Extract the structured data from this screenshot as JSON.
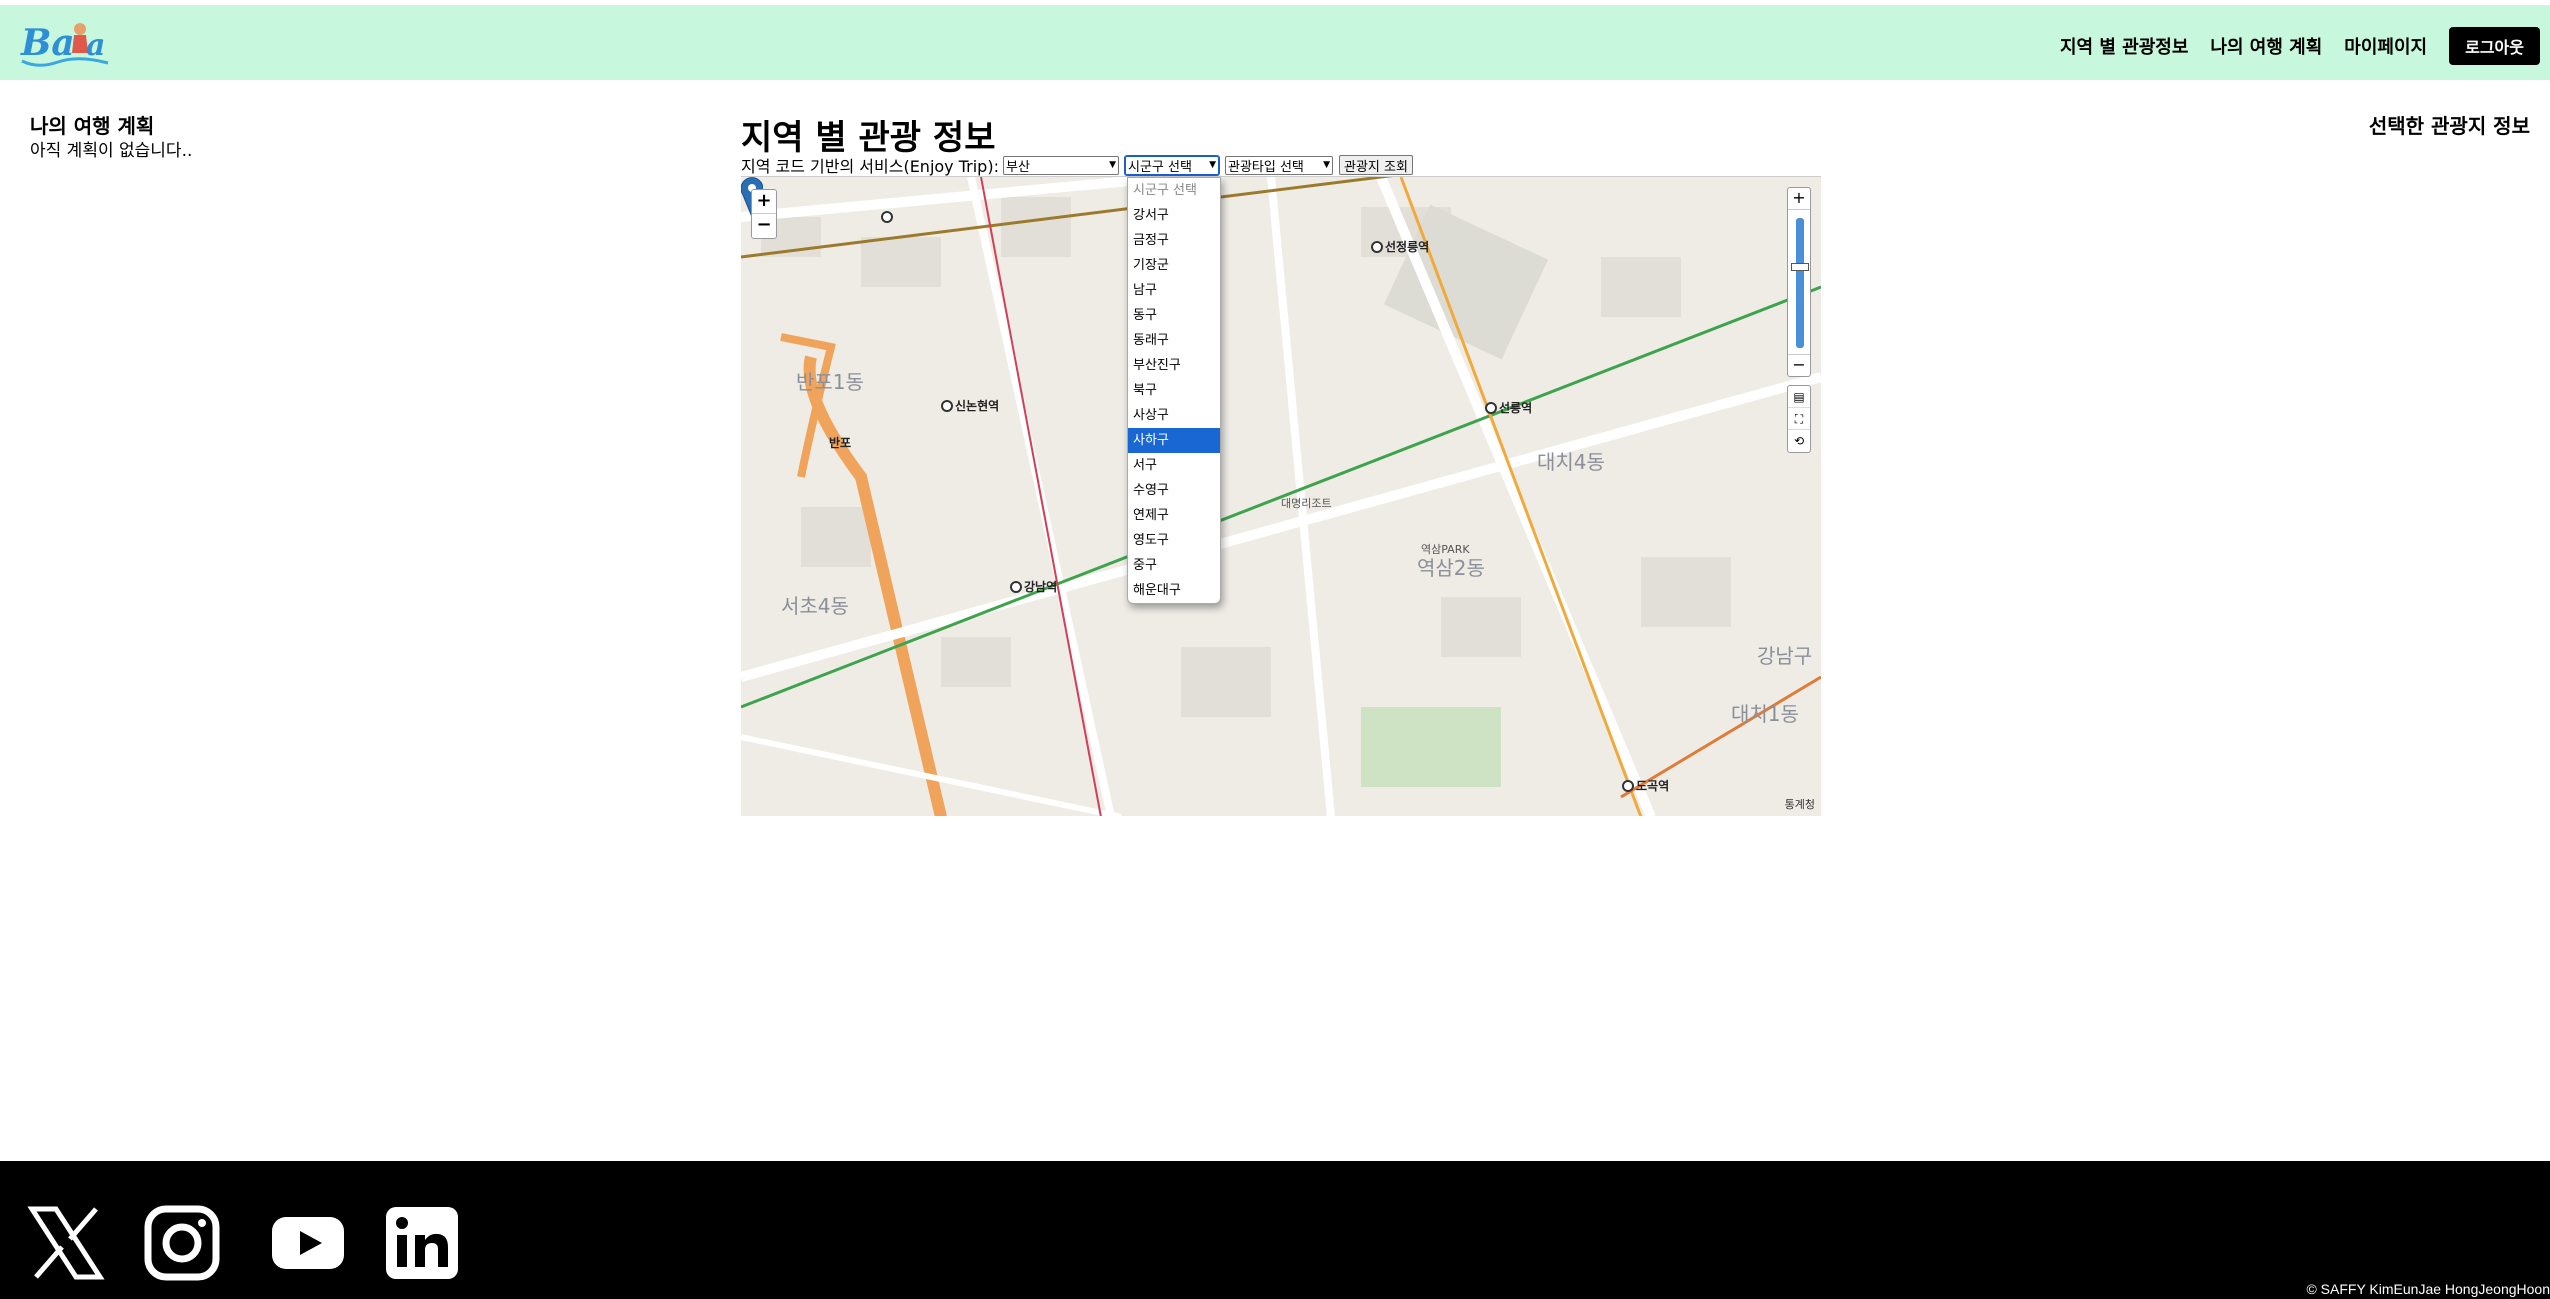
{
  "header": {
    "logo_text": "Baña",
    "nav": [
      {
        "label": "지역 별 관광정보"
      },
      {
        "label": "나의 여행 계획"
      },
      {
        "label": "마이페이지"
      }
    ],
    "logout_label": "로그아웃"
  },
  "left_panel": {
    "title": "나의 여행 계획",
    "empty_text": "아직 계획이 없습니다.."
  },
  "right_panel": {
    "title": "선택한 관광지 정보"
  },
  "main": {
    "title": "지역 별 관광 정보",
    "controls_label": "지역 코드 기반의 서비스(Enjoy Trip):",
    "city_select": "부산",
    "gugun_select": "시군구 선택",
    "type_select": "관광타입 선택",
    "search_button": "관광지 조회",
    "gugun_options": [
      {
        "label": "시군구 선택",
        "placeholder": true
      },
      {
        "label": "강서구"
      },
      {
        "label": "금정구"
      },
      {
        "label": "기장군"
      },
      {
        "label": "남구"
      },
      {
        "label": "동구"
      },
      {
        "label": "동래구"
      },
      {
        "label": "부산진구"
      },
      {
        "label": "북구"
      },
      {
        "label": "사상구"
      },
      {
        "label": "사하구",
        "selected": true
      },
      {
        "label": "서구"
      },
      {
        "label": "수영구"
      },
      {
        "label": "연제구"
      },
      {
        "label": "영도구"
      },
      {
        "label": "중구"
      },
      {
        "label": "해운대구"
      }
    ]
  },
  "map": {
    "labels": [
      {
        "text": "반포1동"
      },
      {
        "text": "서초4동"
      },
      {
        "text": "역삼2동"
      },
      {
        "text": "대치4동"
      },
      {
        "text": "대치1동"
      },
      {
        "text": "강남구"
      },
      {
        "text": "신논현역"
      },
      {
        "text": "강남역"
      },
      {
        "text": "선정릉역"
      },
      {
        "text": "선릉역"
      },
      {
        "text": "도곡역"
      },
      {
        "text": "반포"
      },
      {
        "text": "대명리조트"
      },
      {
        "text": "역삼PARK"
      }
    ],
    "copyright": "통계청"
  },
  "footer": {
    "copyright": "© SAFFY KimEunJae  HongJeongHoon"
  },
  "colors": {
    "header_bg": "#c7f7dd",
    "footer_bg": "#000000",
    "selected_option": "#1967d2",
    "pin": "#2a6fb5"
  }
}
